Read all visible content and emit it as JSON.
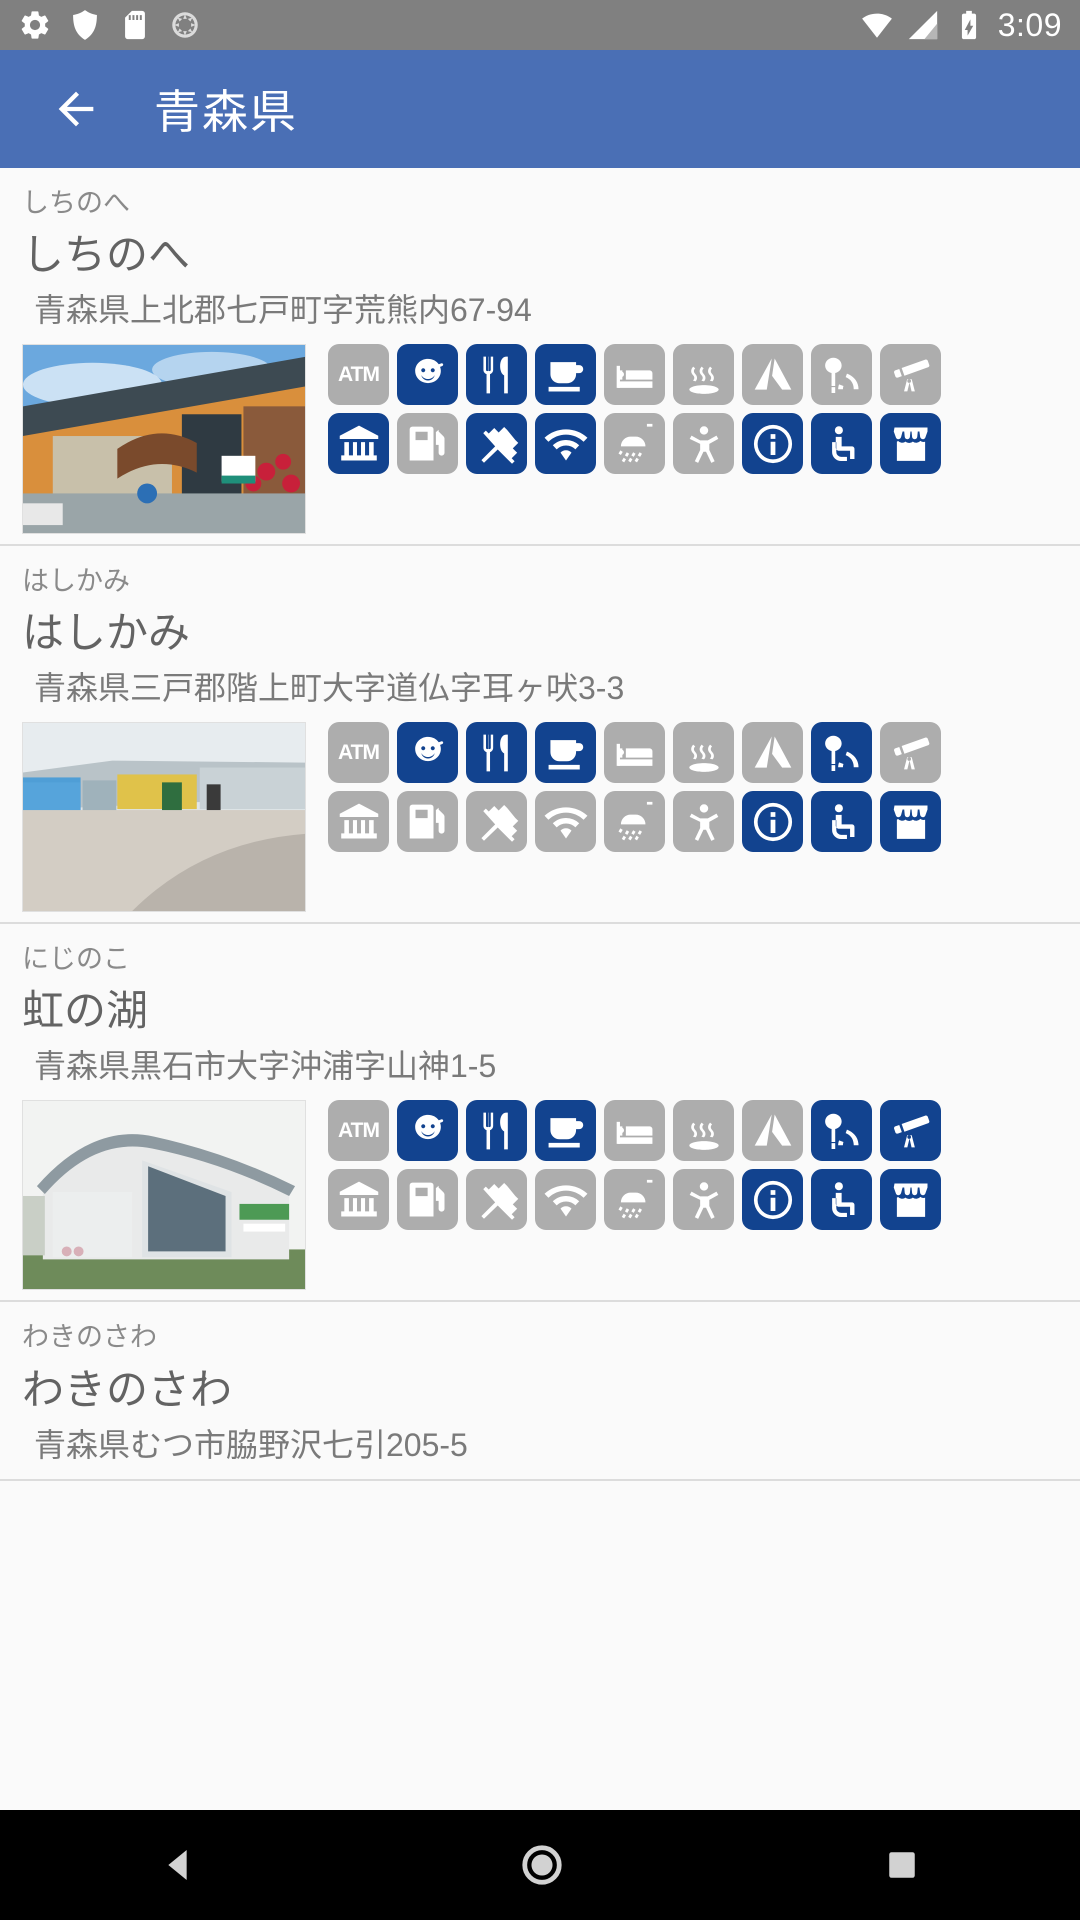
{
  "status_bar": {
    "time": "3:09",
    "left_icons": [
      "gear-icon",
      "shield-icon",
      "sd-card-icon",
      "sync-icon"
    ],
    "right_icons": [
      "wifi-icon",
      "signal-icon",
      "battery-charging-icon"
    ]
  },
  "app_bar": {
    "back_label": "back-arrow",
    "title": "青森県"
  },
  "facility_legend": [
    "atm",
    "baby-room",
    "restaurant",
    "cafe",
    "lodging",
    "hot-spring",
    "camping",
    "park",
    "observatory",
    "bank",
    "gas-station",
    "ev-charging",
    "wifi",
    "shower",
    "playground",
    "information",
    "barrier-free",
    "shop"
  ],
  "colors": {
    "accent": "#4a6fb5",
    "facility_on": "#12438f",
    "facility_off": "#adadad",
    "status_bar": "#808080",
    "page_bg": "#fafafa"
  },
  "list": [
    {
      "reading": "しちのへ",
      "name": "しちのへ",
      "address": "青森県上北郡七戸町字荒熊内67-94",
      "photo": "roadside-station-orange-building-with-roses",
      "facilities": [
        false,
        true,
        true,
        true,
        false,
        false,
        false,
        false,
        false,
        true,
        false,
        true,
        true,
        false,
        false,
        true,
        true,
        true
      ]
    },
    {
      "reading": "はしかみ",
      "name": "はしかみ",
      "address": "青森県三戸郡階上町大字道仏字耳ヶ吠3-3",
      "photo": "roadside-station-wide-plaza-pavement",
      "facilities": [
        false,
        true,
        true,
        true,
        false,
        false,
        false,
        true,
        false,
        false,
        false,
        false,
        false,
        false,
        false,
        true,
        true,
        true
      ]
    },
    {
      "reading": "にじのこ",
      "name": "虹の湖",
      "address": "青森県黒石市大字沖浦字山神1-5",
      "photo": "roadside-station-curved-roof-white-building",
      "facilities": [
        false,
        true,
        true,
        true,
        false,
        false,
        false,
        true,
        true,
        false,
        false,
        false,
        false,
        false,
        false,
        true,
        true,
        true
      ]
    },
    {
      "reading": "わきのさわ",
      "name": "わきのさわ",
      "address": "青森県むつ市脇野沢七引205-5",
      "photo": "",
      "facilities": []
    }
  ],
  "nav_bar": {
    "buttons": [
      "back-triangle-icon",
      "home-circle-icon",
      "recents-square-icon"
    ]
  }
}
